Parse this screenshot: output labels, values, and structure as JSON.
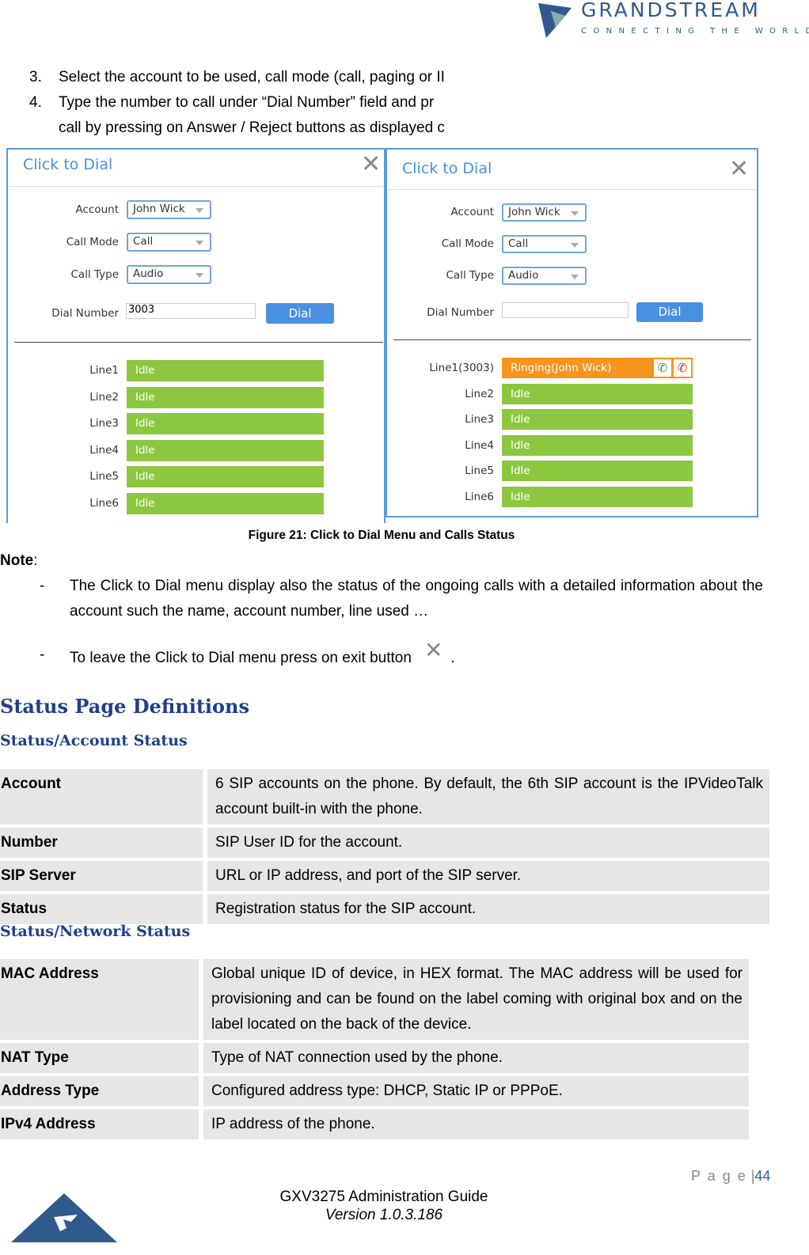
{
  "header": {
    "brand": "GRANDSTREAM",
    "tagline": "CONNECTING THE WORLD"
  },
  "steps": [
    {
      "num": "3.",
      "text": "Select the account to be used, call mode (call, paging or II"
    },
    {
      "num": "4.",
      "text": "Type the number to call under “Dial Number” field and pr"
    },
    {
      "num": "",
      "text": "call by pressing on Answer / Reject buttons as displayed c"
    }
  ],
  "dialogs": [
    {
      "title": "Click to Dial",
      "account_label": "Account",
      "account": "John Wick",
      "mode_label": "Call Mode",
      "mode": "Call",
      "type_label": "Call Type",
      "type": "Audio",
      "dial_label": "Dial Number",
      "dial_value": "3003",
      "dial_button": "Dial",
      "lines": [
        {
          "label": "Line1",
          "status": "Idle"
        },
        {
          "label": "Line2",
          "status": "Idle"
        },
        {
          "label": "Line3",
          "status": "Idle"
        },
        {
          "label": "Line4",
          "status": "Idle"
        },
        {
          "label": "Line5",
          "status": "Idle"
        },
        {
          "label": "Line6",
          "status": "Idle"
        }
      ]
    },
    {
      "title": "Click to Dial",
      "account_label": "Account",
      "account": "John Wick",
      "mode_label": "Call Mode",
      "mode": "Call",
      "type_label": "Call Type",
      "type": "Audio",
      "dial_label": "Dial Number",
      "dial_value": "",
      "dial_button": "Dial",
      "lines": [
        {
          "label": "Line1(3003)",
          "status": "Ringing(John Wick)"
        },
        {
          "label": "Line2",
          "status": "Idle"
        },
        {
          "label": "Line3",
          "status": "Idle"
        },
        {
          "label": "Line4",
          "status": "Idle"
        },
        {
          "label": "Line5",
          "status": "Idle"
        },
        {
          "label": "Line6",
          "status": "Idle"
        }
      ]
    }
  ],
  "figure_caption": "Figure 21: Click to Dial Menu and Calls Status",
  "note": {
    "label": "Note",
    "colon": ":",
    "items": [
      {
        "dash": "-",
        "text": "The Click to Dial menu display also the status of the ongoing calls with a detailed information about the account such the name, account number, line used …"
      },
      {
        "dash": "-",
        "text": "To leave the Click to Dial menu press on exit button",
        "after": "."
      }
    ]
  },
  "section_title": "Status Page Definitions",
  "account_status": {
    "title": "Status/Account Status",
    "rows": [
      {
        "key": "Account",
        "value": "6 SIP accounts on the phone. By default, the 6th SIP account is the IPVideoTalk account built-in with the phone."
      },
      {
        "key": "Number",
        "value": "SIP User ID for the account."
      },
      {
        "key": "SIP Server",
        "value": "URL or IP address, and port of the SIP server."
      },
      {
        "key": "Status",
        "value": "Registration status for the SIP account."
      }
    ]
  },
  "network_status": {
    "title": "Status/Network Status",
    "rows": [
      {
        "key": "MAC Address",
        "value": "Global unique ID of device, in HEX format. The MAC address will be used for provisioning and can be found on the label coming with original box and on the label located on the back of the device."
      },
      {
        "key": "NAT Type",
        "value": "Type of NAT connection used by the phone."
      },
      {
        "key": "Address Type",
        "value": "Configured address type: DHCP, Static IP or PPPoE."
      },
      {
        "key": "IPv4 Address",
        "value": "IP address of the phone."
      }
    ]
  },
  "footer": {
    "page_label": "P a g e",
    "page_number": "44",
    "title": "GXV3275 Administration Guide",
    "version": "Version 1.0.3.186"
  },
  "colors": {
    "brand": "#2f5a8c",
    "heading": "#1f3f8a",
    "idle": "#8dc63f",
    "ringing": "#f7941d",
    "dial_button": "#4a90e2"
  }
}
